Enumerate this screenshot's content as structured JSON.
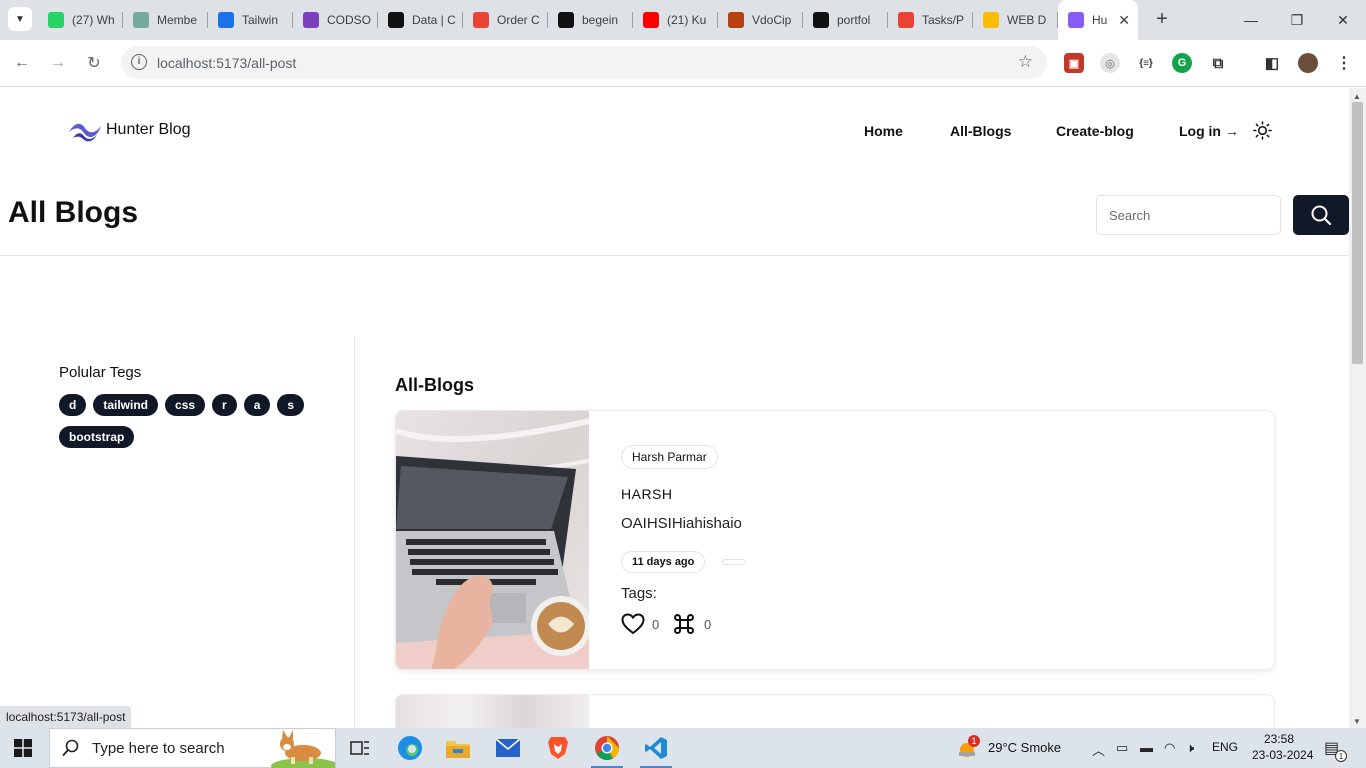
{
  "browser": {
    "tabs": [
      {
        "title": "(27) Wh",
        "icon": "whatsapp-icon",
        "color": "#25d366"
      },
      {
        "title": "Membe",
        "icon": "chatgpt-icon",
        "color": "#74aa9c"
      },
      {
        "title": "Tailwin",
        "icon": "play-icon",
        "color": "#1a73e8"
      },
      {
        "title": "CODSO",
        "icon": "list-icon",
        "color": "#7b3fbf"
      },
      {
        "title": "Data | C",
        "icon": "data-icon",
        "color": "#111111"
      },
      {
        "title": "Order C",
        "icon": "gmail-icon",
        "color": "#ea4335"
      },
      {
        "title": "begein",
        "icon": "triangle-icon",
        "color": "#111111"
      },
      {
        "title": "(21) Ku",
        "icon": "youtube-icon",
        "color": "#ff0000"
      },
      {
        "title": "VdoCip",
        "icon": "vdocipher-icon",
        "color": "#b7410e"
      },
      {
        "title": "portfol",
        "icon": "github-icon",
        "color": "#111111"
      },
      {
        "title": "Tasks/P",
        "icon": "gmail-icon",
        "color": "#ea4335"
      },
      {
        "title": "WEB D",
        "icon": "drive-icon",
        "color": "#fbbc04"
      }
    ],
    "active_tab": {
      "title": "Hu",
      "icon": "vite-icon",
      "color": "#8a5cf6"
    },
    "url": "localhost:5173/all-post",
    "status_url": "localhost:5173/all-post"
  },
  "site": {
    "logo_text": "Hunter Blog",
    "nav": [
      "Home",
      "All-Blogs",
      "Create-blog"
    ],
    "login_label": "Log in →",
    "accent": "#5b5bd6"
  },
  "page": {
    "title": "All Blogs",
    "search_placeholder": "Search"
  },
  "sidebar": {
    "title": "Polular Tegs",
    "tags": [
      "d",
      "tailwind",
      "css",
      "r",
      "a",
      "s",
      "bootstrap"
    ]
  },
  "main": {
    "section_title": "All-Blogs",
    "post": {
      "author": "Harsh Parmar",
      "title": "HARSH",
      "description": "OAIHSIHiahishaio",
      "date": "11 days ago",
      "tags_label": "Tags:",
      "likes": "0",
      "comments": "0"
    }
  },
  "taskbar": {
    "search_placeholder": "Type here to search",
    "weather": "29°C  Smoke",
    "weather_badge": "1",
    "language": "ENG",
    "time": "23:58",
    "date": "23-03-2024",
    "notification_count": "1"
  }
}
